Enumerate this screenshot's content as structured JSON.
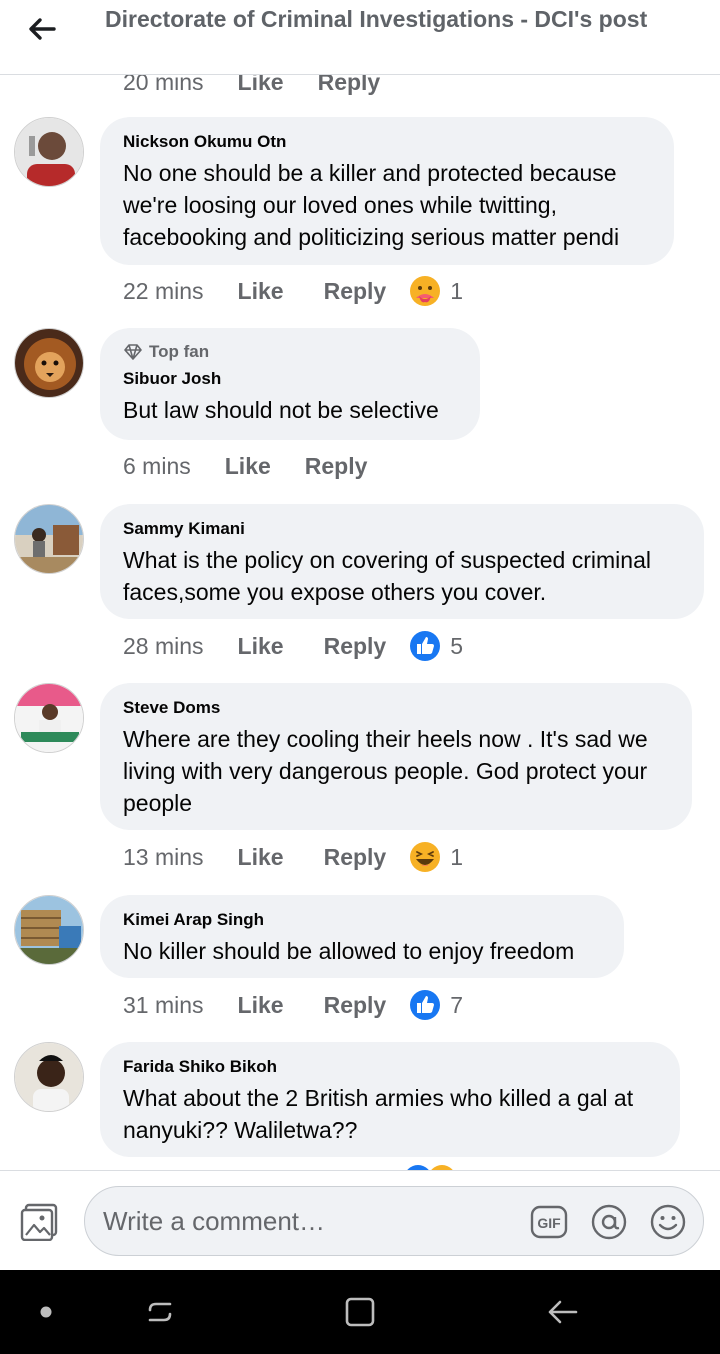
{
  "header": {
    "title": "Directorate of Criminal Investigations - DCI's post"
  },
  "partial_actions": {
    "time": "20 mins",
    "like": "Like",
    "reply": "Reply"
  },
  "comments": [
    {
      "author": "Nickson Okumu Otn",
      "text": "No one should be a killer and protected because we're loosing our loved ones while twitting, facebooking and politicizing serious matter pendi",
      "time": "22 mins",
      "like": "Like",
      "reply": "Reply",
      "reaction_icon": "care-icon",
      "reaction_count": "1"
    },
    {
      "badge": "Top fan",
      "author": "Sibuor Josh",
      "text": "But law should not be selective",
      "time": "6 mins",
      "like": "Like",
      "reply": "Reply"
    },
    {
      "author": "Sammy Kimani",
      "text": "What is the policy on covering of suspected criminal faces,some you expose others you cover.",
      "time": "28 mins",
      "like": "Like",
      "reply": "Reply",
      "reaction_icon": "like-icon",
      "reaction_count": "5"
    },
    {
      "author": "Steve Doms",
      "text": "Where are they cooling their heels now . It's sad we living with very dangerous people. God protect your people",
      "time": "13 mins",
      "like": "Like",
      "reply": "Reply",
      "reaction_icon": "haha-icon",
      "reaction_count": "1"
    },
    {
      "author": "Kimei Arap Singh",
      "text": "No killer should be allowed to enjoy freedom",
      "time": "31 mins",
      "like": "Like",
      "reply": "Reply",
      "reaction_icon": "like-icon",
      "reaction_count": "7"
    },
    {
      "author": "Farida Shiko Bikoh",
      "text": "What about the 2 British armies who killed a gal at nanyuki?? Waliletwa??"
    }
  ],
  "composer": {
    "placeholder": "Write a comment…",
    "gif_label": "GIF"
  },
  "colors": {
    "like_blue": "#1877f2",
    "bubble": "#f0f2f5",
    "muted": "#65676b",
    "haha_yellow": "#f7b125"
  }
}
